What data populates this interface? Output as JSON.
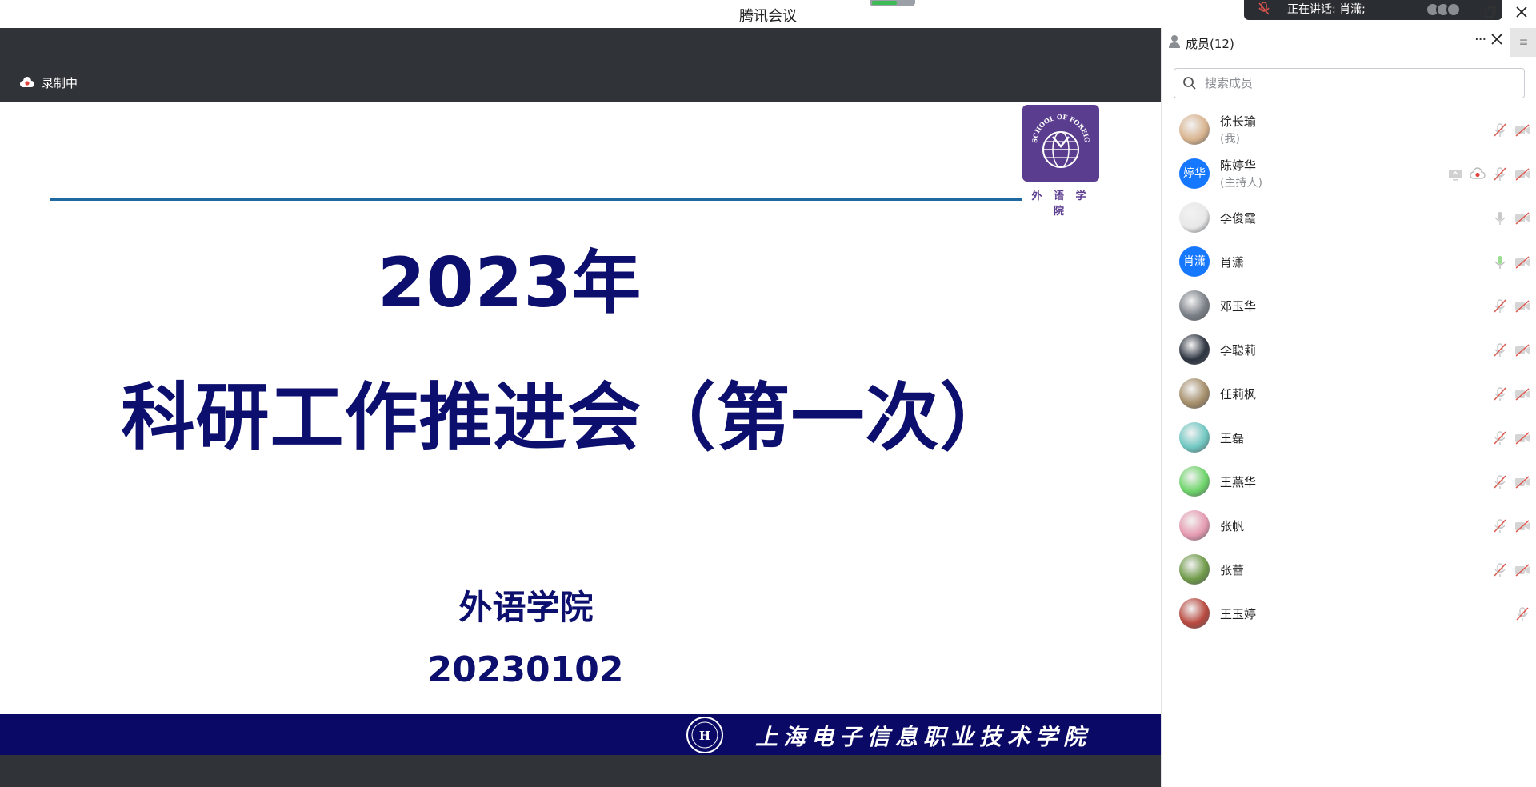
{
  "app": {
    "title": "腾讯会议"
  },
  "network": {
    "level": 0.6,
    "color": "#3dbb55"
  },
  "speaking": {
    "text": "正在讲话: 肖潇;"
  },
  "recording": {
    "label": "录制中"
  },
  "slide": {
    "year": "2023年",
    "title": "科研工作推进会（第一次）",
    "department": "外语学院",
    "date": "20230102",
    "logo_label": "外 语 学 院",
    "logo_text": "SCHOOL OF FOREIGN LANGUAGES",
    "footer_school": "上海电子信息职业技术学院",
    "colors": {
      "title": "#0d0f6e",
      "footer": "#0a0a66",
      "logo": "#5b3d8f",
      "line": "#1e6aa0"
    }
  },
  "members_panel": {
    "title": "成员(12)",
    "search_placeholder": "搜索成员",
    "members": [
      {
        "name": "徐长瑜",
        "role": "(我)",
        "avatar_type": "photo",
        "avatar_color": "#d9b48f",
        "icons": [
          "mic-muted-icon",
          "camera-off-icon"
        ]
      },
      {
        "name": "陈婷华",
        "role": "(主持人)",
        "avatar_type": "text",
        "avatar_text": "婷华",
        "avatar_color": "#1677ff",
        "icons": [
          "screen-share-icon",
          "cloud-record-icon",
          "mic-muted-icon",
          "camera-off-icon"
        ]
      },
      {
        "name": "李俊霞",
        "role": "",
        "avatar_type": "photo",
        "avatar_color": "#e8e8e8",
        "icons": [
          "mic-icon",
          "camera-off-icon"
        ]
      },
      {
        "name": "肖潇",
        "role": "",
        "avatar_type": "text",
        "avatar_text": "肖潇",
        "avatar_color": "#1677ff",
        "icons": [
          "mic-active-icon",
          "camera-off-icon"
        ]
      },
      {
        "name": "邓玉华",
        "role": "",
        "avatar_type": "photo",
        "avatar_color": "#7a7f86",
        "icons": [
          "mic-muted-icon",
          "camera-off-icon"
        ]
      },
      {
        "name": "李聪莉",
        "role": "",
        "avatar_type": "photo",
        "avatar_color": "#2d3440",
        "icons": [
          "mic-muted-icon",
          "camera-off-icon"
        ]
      },
      {
        "name": "任莉枫",
        "role": "",
        "avatar_type": "photo",
        "avatar_color": "#a58e6a",
        "icons": [
          "mic-muted-icon",
          "camera-off-icon"
        ]
      },
      {
        "name": "王磊",
        "role": "",
        "avatar_type": "photo",
        "avatar_color": "#6fc7c1",
        "icons": [
          "mic-muted-icon",
          "camera-off-icon"
        ]
      },
      {
        "name": "王燕华",
        "role": "",
        "avatar_type": "photo",
        "avatar_color": "#6ed46a",
        "icons": [
          "mic-muted-icon",
          "camera-off-icon"
        ]
      },
      {
        "name": "张帆",
        "role": "",
        "avatar_type": "photo",
        "avatar_color": "#e59ab0",
        "icons": [
          "mic-muted-icon",
          "camera-off-icon"
        ]
      },
      {
        "name": "张蕾",
        "role": "",
        "avatar_type": "photo",
        "avatar_color": "#6f9a48",
        "icons": [
          "mic-muted-icon",
          "camera-off-icon"
        ]
      },
      {
        "name": "王玉婷",
        "role": "",
        "avatar_type": "photo",
        "avatar_color": "#b8483e",
        "icons": [
          "mic-muted-icon"
        ]
      }
    ]
  }
}
